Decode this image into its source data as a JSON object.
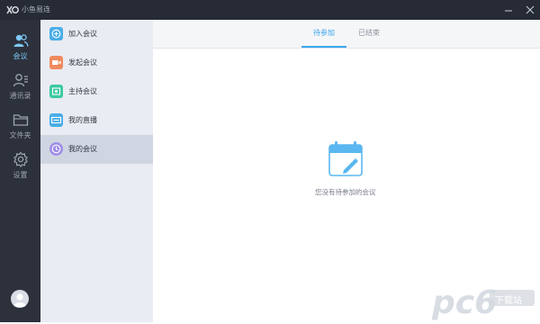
{
  "app": {
    "title": "小鱼易连"
  },
  "window_controls": {
    "minimize": "minimize-icon",
    "close": "close-icon"
  },
  "nav": {
    "items": [
      {
        "label": "会议",
        "icon": "people-icon",
        "active": true
      },
      {
        "label": "通讯录",
        "icon": "contacts-icon",
        "active": false
      },
      {
        "label": "文件夹",
        "icon": "folder-icon",
        "active": false
      },
      {
        "label": "设置",
        "icon": "gear-icon",
        "active": false
      }
    ]
  },
  "submenu": {
    "items": [
      {
        "label": "加入会议",
        "icon": "plus-icon",
        "color": "#4aaee8",
        "active": false
      },
      {
        "label": "发起会议",
        "icon": "video-icon",
        "color": "#f08a5d",
        "active": false
      },
      {
        "label": "主持会议",
        "icon": "host-icon",
        "color": "#3ccaa0",
        "active": false
      },
      {
        "label": "我的直播",
        "icon": "live-icon",
        "color": "#4aaee8",
        "active": false
      },
      {
        "label": "我的会议",
        "icon": "clock-icon",
        "color": "#9f8fe8",
        "active": true
      }
    ]
  },
  "tabs": [
    {
      "label": "待参加",
      "active": true
    },
    {
      "label": "已结束",
      "active": false
    }
  ],
  "empty_state": {
    "icon": "calendar-edit-icon",
    "message": "您没有待参加的会议"
  },
  "watermark": {
    "text": "pc6",
    "sub": "下载站"
  },
  "colors": {
    "accent": "#3aa6ec",
    "titlebar": "#262b35",
    "nav_bg": "#2c313c",
    "submenu_bg": "#e9ecf2"
  }
}
